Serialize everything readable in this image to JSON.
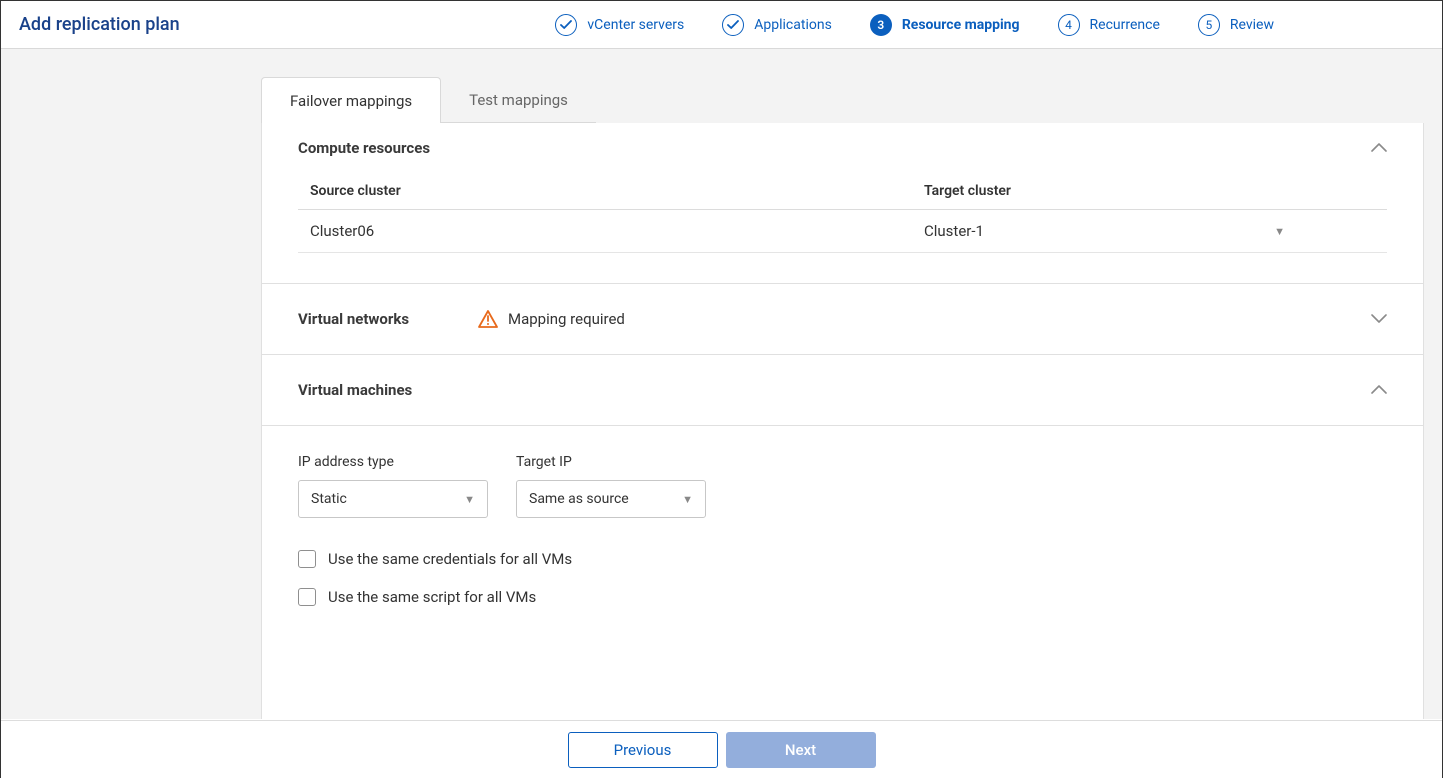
{
  "header": {
    "title": "Add replication plan",
    "steps": [
      {
        "label": "vCenter servers",
        "num": "1",
        "state": "done"
      },
      {
        "label": "Applications",
        "num": "2",
        "state": "done"
      },
      {
        "label": "Resource mapping",
        "num": "3",
        "state": "current"
      },
      {
        "label": "Recurrence",
        "num": "4",
        "state": "todo"
      },
      {
        "label": "Review",
        "num": "5",
        "state": "todo"
      }
    ]
  },
  "tabs": {
    "failover": "Failover mappings",
    "test": "Test mappings"
  },
  "compute": {
    "title": "Compute resources",
    "headers": {
      "src": "Source cluster",
      "tgt": "Target cluster"
    },
    "rows": [
      {
        "src": "Cluster06",
        "tgt": "Cluster-1"
      }
    ]
  },
  "networks": {
    "title": "Virtual networks",
    "status": "Mapping required"
  },
  "vms": {
    "title": "Virtual machines",
    "ip_type_label": "IP address type",
    "ip_type_value": "Static",
    "target_ip_label": "Target IP",
    "target_ip_value": "Same as source",
    "check_cred": "Use the same credentials for all VMs",
    "check_script": "Use the same script for all VMs"
  },
  "footer": {
    "previous": "Previous",
    "next": "Next"
  }
}
